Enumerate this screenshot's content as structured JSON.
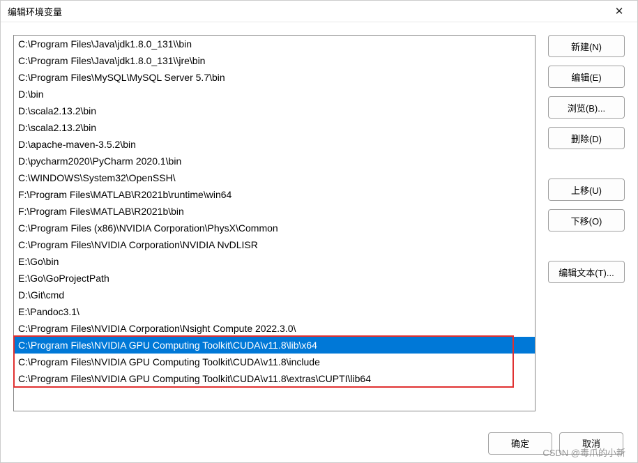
{
  "window": {
    "title": "编辑环境变量"
  },
  "list": {
    "selected_index": 18,
    "highlight_start": 18,
    "highlight_end": 20,
    "items": [
      "C:\\Program Files\\Java\\jdk1.8.0_131\\\\bin",
      "C:\\Program Files\\Java\\jdk1.8.0_131\\\\jre\\bin",
      "C:\\Program Files\\MySQL\\MySQL Server 5.7\\bin",
      "D:\\bin",
      "D:\\scala2.13.2\\bin",
      "D:\\scala2.13.2\\bin",
      "D:\\apache-maven-3.5.2\\bin",
      "D:\\pycharm2020\\PyCharm 2020.1\\bin",
      "C:\\WINDOWS\\System32\\OpenSSH\\",
      "F:\\Program Files\\MATLAB\\R2021b\\runtime\\win64",
      "F:\\Program Files\\MATLAB\\R2021b\\bin",
      "C:\\Program Files (x86)\\NVIDIA Corporation\\PhysX\\Common",
      "C:\\Program Files\\NVIDIA Corporation\\NVIDIA NvDLISR",
      "E:\\Go\\bin",
      "E:\\Go\\GoProjectPath",
      "D:\\Git\\cmd",
      "E:\\Pandoc3.1\\",
      "C:\\Program Files\\NVIDIA Corporation\\Nsight Compute 2022.3.0\\",
      "C:\\Program Files\\NVIDIA GPU Computing Toolkit\\CUDA\\v11.8\\lib\\x64",
      "C:\\Program Files\\NVIDIA GPU Computing Toolkit\\CUDA\\v11.8\\include",
      "C:\\Program Files\\NVIDIA GPU Computing Toolkit\\CUDA\\v11.8\\extras\\CUPTI\\lib64"
    ]
  },
  "buttons": {
    "new": "新建(N)",
    "edit": "编辑(E)",
    "browse": "浏览(B)...",
    "delete": "删除(D)",
    "move_up": "上移(U)",
    "move_down": "下移(O)",
    "edit_text": "编辑文本(T)...",
    "ok": "确定",
    "cancel": "取消"
  },
  "watermark": "CSDN @毒爪的小新"
}
